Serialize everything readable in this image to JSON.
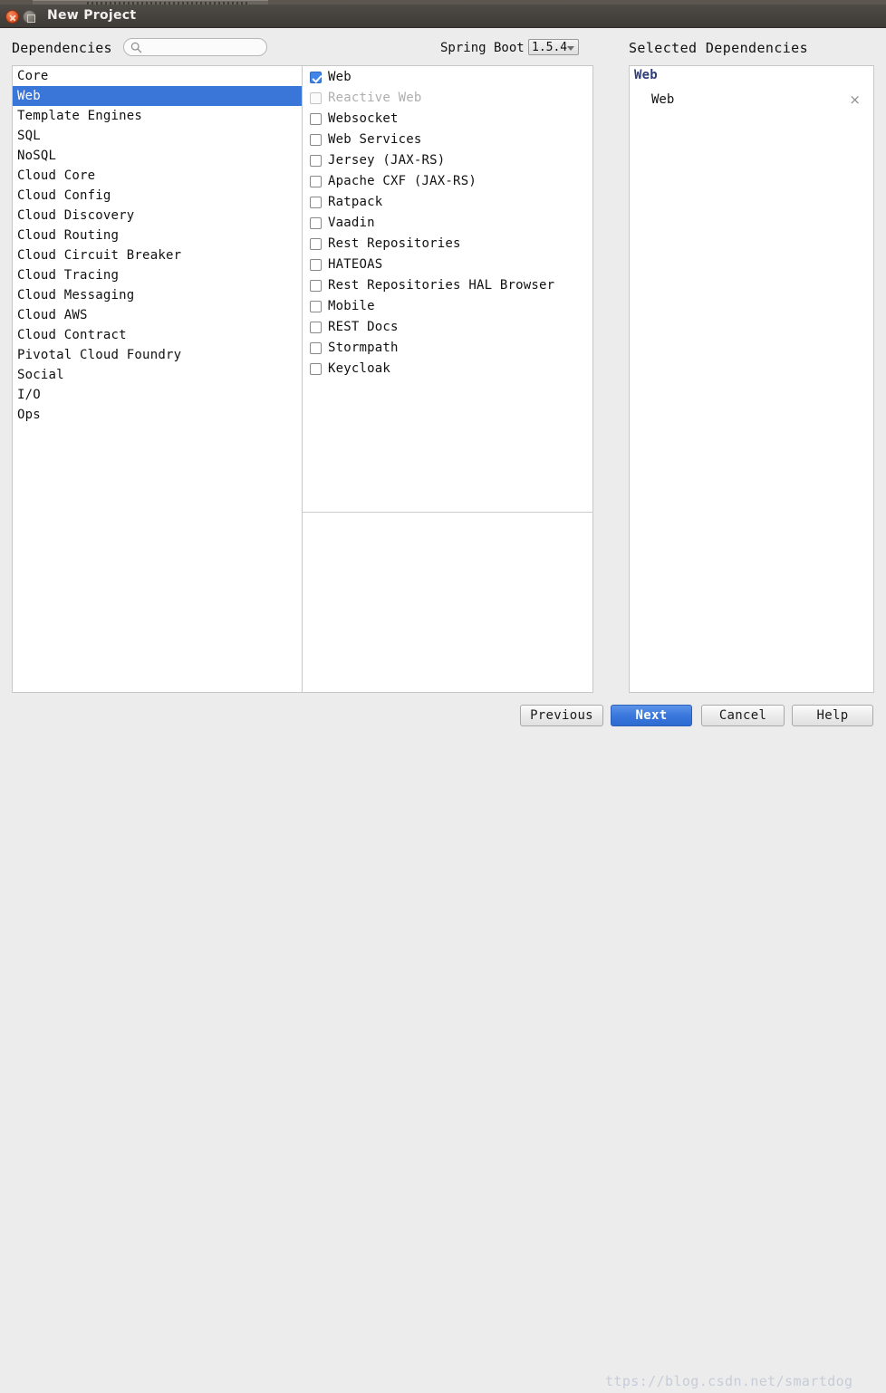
{
  "window": {
    "title": "New Project",
    "close_icon": "close-icon",
    "maximize_icon": "maximize-icon"
  },
  "header": {
    "dependencies_label": "Dependencies",
    "search_placeholder": "",
    "search_value": "",
    "search_icon": "search-icon",
    "springboot_label": "Spring Boot",
    "version_value": "1.5.4",
    "version_options": [
      "1.5.4"
    ],
    "selected_dependencies_label": "Selected Dependencies"
  },
  "categories": {
    "selected": "Web",
    "items": [
      {
        "label": "Core"
      },
      {
        "label": "Web"
      },
      {
        "label": "Template Engines"
      },
      {
        "label": "SQL"
      },
      {
        "label": "NoSQL"
      },
      {
        "label": "Cloud Core"
      },
      {
        "label": "Cloud Config"
      },
      {
        "label": "Cloud Discovery"
      },
      {
        "label": "Cloud Routing"
      },
      {
        "label": "Cloud Circuit Breaker"
      },
      {
        "label": "Cloud Tracing"
      },
      {
        "label": "Cloud Messaging"
      },
      {
        "label": "Cloud AWS"
      },
      {
        "label": "Cloud Contract"
      },
      {
        "label": "Pivotal Cloud Foundry"
      },
      {
        "label": "Social"
      },
      {
        "label": "I/O"
      },
      {
        "label": "Ops"
      }
    ]
  },
  "modules": {
    "items": [
      {
        "label": "Web",
        "checked": true,
        "disabled": false
      },
      {
        "label": "Reactive Web",
        "checked": false,
        "disabled": true
      },
      {
        "label": "Websocket",
        "checked": false,
        "disabled": false
      },
      {
        "label": "Web Services",
        "checked": false,
        "disabled": false
      },
      {
        "label": "Jersey (JAX-RS)",
        "checked": false,
        "disabled": false
      },
      {
        "label": "Apache CXF (JAX-RS)",
        "checked": false,
        "disabled": false
      },
      {
        "label": "Ratpack",
        "checked": false,
        "disabled": false
      },
      {
        "label": "Vaadin",
        "checked": false,
        "disabled": false
      },
      {
        "label": "Rest Repositories",
        "checked": false,
        "disabled": false
      },
      {
        "label": "HATEOAS",
        "checked": false,
        "disabled": false
      },
      {
        "label": "Rest Repositories HAL Browser",
        "checked": false,
        "disabled": false
      },
      {
        "label": "Mobile",
        "checked": false,
        "disabled": false
      },
      {
        "label": "REST Docs",
        "checked": false,
        "disabled": false
      },
      {
        "label": "Stormpath",
        "checked": false,
        "disabled": false
      },
      {
        "label": "Keycloak",
        "checked": false,
        "disabled": false
      }
    ]
  },
  "selected_dependencies": {
    "group_label": "Web",
    "item_label": "Web",
    "remove_icon": "×"
  },
  "footer": {
    "previous_label": "Previous",
    "next_label": "Next",
    "cancel_label": "Cancel",
    "help_label": "Help"
  },
  "watermark": {
    "text": "ttps://blog.csdn.net/smartdog"
  },
  "colors": {
    "selection_blue": "#3a76d8",
    "checkbox_blue": "#4285e8",
    "primary_button_blue": "#3a78dd",
    "group_label_navy": "#2f3e7a",
    "titlebar": "#45413d",
    "dialog_background": "#ececec"
  }
}
